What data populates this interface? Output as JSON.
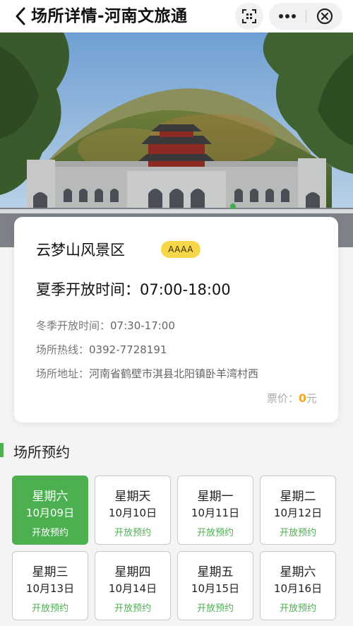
{
  "header": {
    "title": "场所详情-河南文旅通"
  },
  "venue": {
    "name": "云梦山风景区",
    "rating": "AAAA",
    "summer_hours": "夏季开放时间：07:00-18:00",
    "winter_label": "冬季开放时间：",
    "winter_value": "07:30-17:00",
    "hotline_label": "场所热线：",
    "hotline_value": "0392-7728191",
    "address_label": "场所地址：",
    "address_value": "河南省鹤壁市淇县北阳镇卧羊湾村西",
    "price_label": "票价：",
    "price_value": "0",
    "price_unit": "元"
  },
  "booking": {
    "section_title": "场所预约",
    "accent_color": "#4caf50",
    "days": [
      {
        "week": "星期六",
        "date": "10月09日",
        "status": "开放预约",
        "selected": true
      },
      {
        "week": "星期天",
        "date": "10月10日",
        "status": "开放预约",
        "selected": false
      },
      {
        "week": "星期一",
        "date": "10月11日",
        "status": "开放预约",
        "selected": false
      },
      {
        "week": "星期二",
        "date": "10月12日",
        "status": "开放预约",
        "selected": false
      },
      {
        "week": "星期三",
        "date": "10月13日",
        "status": "开放预约",
        "selected": false
      },
      {
        "week": "星期四",
        "date": "10月14日",
        "status": "开放预约",
        "selected": false
      },
      {
        "week": "星期五",
        "date": "10月15日",
        "status": "开放预约",
        "selected": false
      },
      {
        "week": "星期六",
        "date": "10月16日",
        "status": "开放预约",
        "selected": false
      }
    ]
  },
  "icons": {
    "back": "chevron-left-icon",
    "scan": "scan-icon",
    "more": "more-dots-icon",
    "close": "close-circle-icon"
  }
}
